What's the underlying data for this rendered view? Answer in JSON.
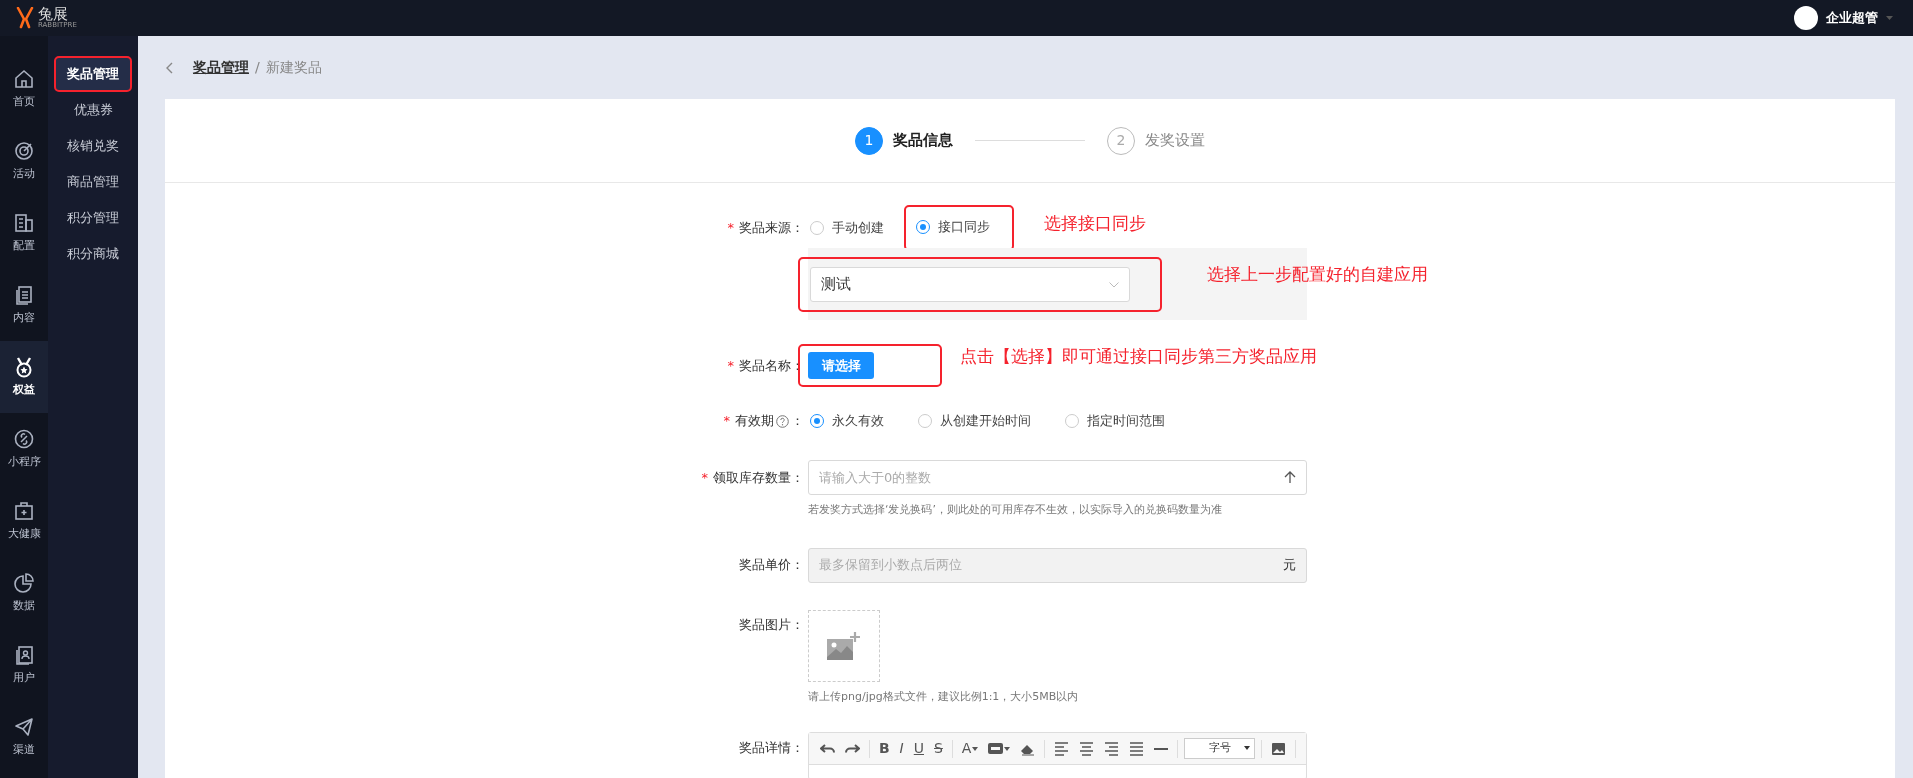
{
  "topbar": {
    "logo_text": "兔展",
    "logo_subtext": "RABBITPRE",
    "user": "企业超管"
  },
  "rail": [
    {
      "label": "首页",
      "selected": false
    },
    {
      "label": "活动",
      "selected": false
    },
    {
      "label": "配置",
      "selected": false
    },
    {
      "label": "内容",
      "selected": false
    },
    {
      "label": "权益",
      "selected": true
    },
    {
      "label": "小程序",
      "selected": false
    },
    {
      "label": "大健康",
      "selected": false
    },
    {
      "label": "数据",
      "selected": false
    },
    {
      "label": "用户",
      "selected": false
    },
    {
      "label": "渠道",
      "selected": false
    }
  ],
  "submenu": [
    {
      "label": "奖品管理",
      "selected": true,
      "highlighted": true
    },
    {
      "label": "优惠券",
      "selected": false,
      "highlighted": false
    },
    {
      "label": "核销兑奖",
      "selected": false,
      "highlighted": false
    },
    {
      "label": "商品管理",
      "selected": false,
      "highlighted": false
    },
    {
      "label": "积分管理",
      "selected": false,
      "highlighted": false
    },
    {
      "label": "积分商城",
      "selected": false,
      "highlighted": false
    }
  ],
  "breadcrumb": {
    "parent": "奖品管理",
    "separator": "/",
    "current": "新建奖品"
  },
  "steps": [
    {
      "number": "1",
      "label": "奖品信息",
      "active": true
    },
    {
      "number": "2",
      "label": "发奖设置",
      "active": false
    }
  ],
  "form": [
    {
      "kind": "radio",
      "required_mark": "*",
      "label": "奖品来源：",
      "options": [
        {
          "label": "手动创建",
          "checked": false,
          "highlighted": false
        },
        {
          "label": "接口同步",
          "checked": true,
          "highlighted": true
        }
      ],
      "annotation": "选择接口同步"
    },
    {
      "kind": "select",
      "value": "测试",
      "highlighted": true,
      "annotation": "选择上一步配置好的自建应用"
    },
    {
      "kind": "button",
      "required_mark": "*",
      "label": "奖品名称：",
      "button": "请选择",
      "highlighted": true,
      "annotation": "点击【选择】即可通过接口同步第三方奖品应用"
    },
    {
      "kind": "radio",
      "required_mark": "*",
      "label": "有效期",
      "help": true,
      "colon": "：",
      "options": [
        {
          "label": "永久有效",
          "checked": true,
          "highlighted": false
        },
        {
          "label": "从创建开始时间",
          "checked": false,
          "highlighted": false
        },
        {
          "label": "指定时间范围",
          "checked": false,
          "highlighted": false
        }
      ]
    },
    {
      "kind": "number",
      "required_mark": "*",
      "label": "领取库存数量：",
      "placeholder": "请输入大于0的整数",
      "hint": "若发奖方式选择‘发兑换码’，则此处的可用库存不生效，以实际导入的兑换码数量为准"
    },
    {
      "kind": "money",
      "label": "奖品单价：",
      "placeholder": "最多保留到小数点后两位",
      "suffix": "元",
      "disabled": true
    },
    {
      "kind": "upload",
      "label": "奖品图片：",
      "hint": "请上传png/jpg格式文件，建议比例1:1，大小5MB以内"
    },
    {
      "kind": "editor",
      "label": "奖品详情：",
      "font_size": "字号",
      "toolbar": [
        {
          "kind": "icon",
          "caret": false
        },
        {
          "kind": "icon",
          "caret": false
        },
        {
          "kind": "sep"
        },
        {
          "kind": "glyph",
          "glyph": "B",
          "caret": false
        },
        {
          "kind": "glyph",
          "glyph": "I",
          "caret": false
        },
        {
          "kind": "glyph",
          "glyph": "U",
          "caret": false
        },
        {
          "kind": "glyph",
          "glyph": "S",
          "caret": false
        },
        {
          "kind": "sep"
        },
        {
          "kind": "glyph",
          "glyph": "A",
          "caret": true
        },
        {
          "kind": "icon",
          "caret": true
        },
        {
          "kind": "icon",
          "caret": false
        },
        {
          "kind": "sep"
        },
        {
          "kind": "icon",
          "caret": false
        },
        {
          "kind": "icon",
          "caret": false
        },
        {
          "kind": "icon",
          "caret": false
        },
        {
          "kind": "icon",
          "caret": false
        },
        {
          "kind": "icon",
          "caret": false
        },
        {
          "kind": "sep"
        },
        {
          "kind": "fontsize"
        },
        {
          "kind": "sep"
        },
        {
          "kind": "icon",
          "caret": false
        },
        {
          "kind": "sep"
        }
      ]
    }
  ]
}
